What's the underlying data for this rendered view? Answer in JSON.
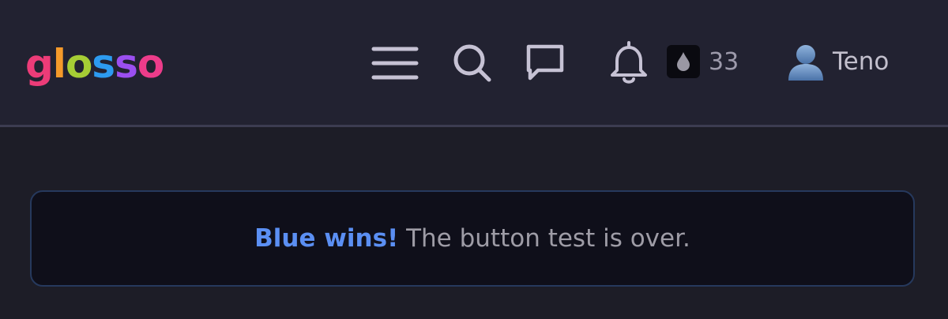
{
  "header": {
    "logo": {
      "letters": [
        "g",
        "l",
        "o",
        "s",
        "s",
        "o"
      ],
      "colors": [
        "#ec3c78",
        "#f59a2a",
        "#a6cd35",
        "#2d9bf0",
        "#9b4ff0",
        "#ec3c8a"
      ]
    },
    "icons": {
      "menu": "menu-icon",
      "search": "search-icon",
      "messages": "chat-bubble-icon",
      "notifications": "bell-icon",
      "points": "drop-icon",
      "user": "user-icon"
    },
    "points_count": "33",
    "username": "Teno"
  },
  "banner": {
    "strong": "Blue wins!",
    "text": " The button test is over.",
    "accent_color": "#5b8ff3"
  }
}
